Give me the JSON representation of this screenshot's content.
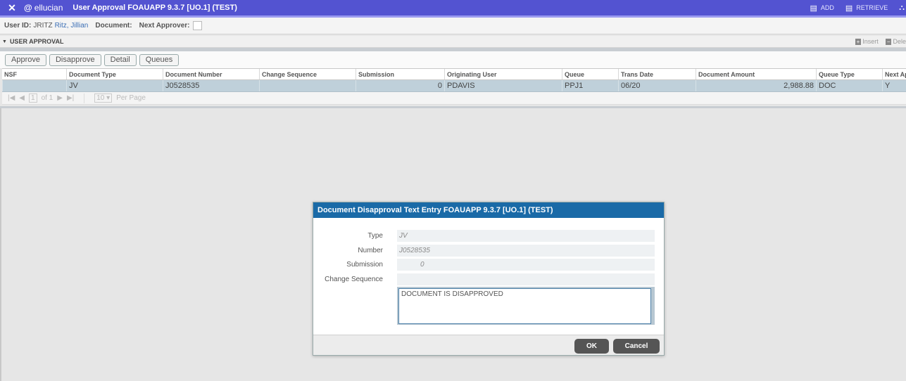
{
  "header": {
    "close_icon": "close-icon",
    "logo_text": "ellucian",
    "title": "User Approval FOAUAPP 9.3.7 [UO.1] (TEST)",
    "actions": [
      {
        "label": "ADD",
        "icon": "add-doc-icon"
      },
      {
        "label": "RETRIEVE",
        "icon": "retrieve-doc-icon"
      }
    ]
  },
  "key_block": {
    "user_id_label": "User ID:",
    "user_id_value": "JRITZ",
    "user_name": "Ritz, Jillian",
    "document_label": "Document:",
    "next_approver_label": "Next Approver:"
  },
  "section": {
    "title": "USER APPROVAL",
    "insert_label": "Insert",
    "delete_label": "Dele"
  },
  "buttons": {
    "approve": "Approve",
    "disapprove": "Disapprove",
    "detail": "Detail",
    "queues": "Queues"
  },
  "grid": {
    "columns": [
      "NSF",
      "Document Type",
      "Document Number",
      "Change Sequence",
      "Submission",
      "Originating User",
      "Queue",
      "Trans Date",
      "Document Amount",
      "Queue Type",
      "Next Ap"
    ],
    "row": {
      "nsf": "",
      "document_type": "JV",
      "document_number": "J0528535",
      "change_sequence": "",
      "submission": "0",
      "originating_user": "PDAVIS",
      "queue": "PPJ1",
      "trans_date": "06/20",
      "document_amount": "2,988.88",
      "queue_type": "DOC",
      "next_approver": "Y"
    },
    "pager": {
      "page": "1",
      "of_label": "of 1",
      "per_page_value": "10",
      "per_page_label": "Per Page"
    }
  },
  "dialog": {
    "title": "Document Disapproval Text Entry FOAUAPP 9.3.7 [UO.1] (TEST)",
    "type_label": "Type",
    "type_value": "JV",
    "number_label": "Number",
    "number_value": "J0528535",
    "submission_label": "Submission",
    "submission_value": "0",
    "change_sequence_label": "Change Sequence",
    "change_sequence_value": "",
    "text_value": "DOCUMENT IS DISAPPROVED",
    "ok_label": "OK",
    "cancel_label": "Cancel"
  }
}
